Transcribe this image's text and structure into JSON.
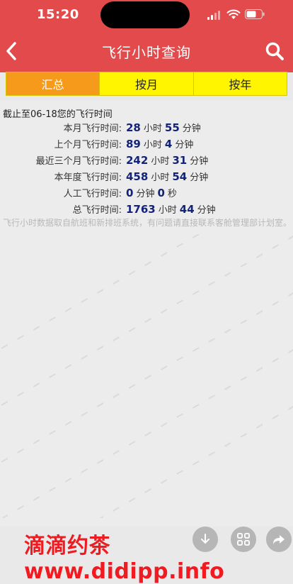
{
  "status": {
    "time": "15:20"
  },
  "nav": {
    "title": "飞行小时查询"
  },
  "tabs": [
    {
      "label": "汇总",
      "active": true
    },
    {
      "label": "按月",
      "active": false
    },
    {
      "label": "按年",
      "active": false
    }
  ],
  "summary": {
    "as_of": "截止至06-18您的飞行时间",
    "rows": [
      {
        "label": "本月飞行时间:",
        "v1": "28",
        "u1": "小时",
        "v2": "55",
        "u2": "分钟"
      },
      {
        "label": "上个月飞行时间:",
        "v1": "89",
        "u1": "小时",
        "v2": "4",
        "u2": "分钟"
      },
      {
        "label": "最近三个月飞行时间:",
        "v1": "242",
        "u1": "小时",
        "v2": "31",
        "u2": "分钟"
      },
      {
        "label": "本年度飞行时间:",
        "v1": "458",
        "u1": "小时",
        "v2": "54",
        "u2": "分钟"
      },
      {
        "label": "人工飞行时间:",
        "v1": "0",
        "u1": "分钟",
        "v2": "0",
        "u2": "秒"
      },
      {
        "label": "总飞行时间:",
        "v1": "1763",
        "u1": "小时",
        "v2": "44",
        "u2": "分钟"
      }
    ],
    "note": "飞行小时数据取自航班和新排班系统，有问题请直接联系客舱管理部计划室。"
  },
  "branding": {
    "text": "滴滴约茶 www.didipp.info"
  },
  "colors": {
    "header": "#e24a4b",
    "tab_active": "#f59a1b",
    "tab_bg": "#fff500",
    "value": "#13237a",
    "brand": "#f01a20"
  }
}
